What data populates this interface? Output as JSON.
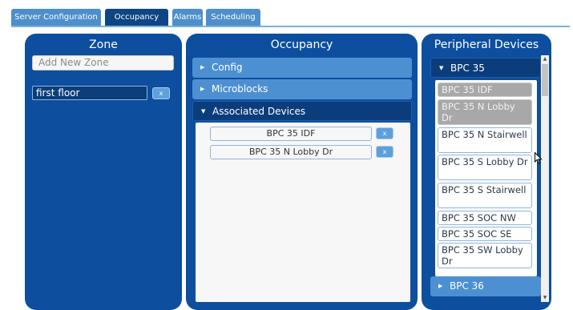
{
  "tabs": [
    {
      "label": "Server Configuration"
    },
    {
      "label": "Occupancy"
    },
    {
      "label": "Alarms"
    },
    {
      "label": "Scheduling"
    }
  ],
  "zone": {
    "title": "Zone",
    "input_placeholder": "Add New Zone",
    "zones": [
      {
        "label": "first floor",
        "remove_label": "x"
      }
    ]
  },
  "occupancy": {
    "title": "Occupancy",
    "sections": [
      {
        "label": "Config",
        "expanded": false
      },
      {
        "label": "Microblocks",
        "expanded": false
      },
      {
        "label": "Associated Devices",
        "expanded": true
      }
    ],
    "associated_devices": [
      {
        "label": "BPC 35 IDF",
        "remove_label": "x"
      },
      {
        "label": "BPC 35 N Lobby Dr",
        "remove_label": "x"
      }
    ]
  },
  "peripherals": {
    "title": "Peripheral Devices",
    "groups": [
      {
        "label": "BPC 35",
        "expanded": true
      },
      {
        "label": "BPC 36",
        "expanded": false
      }
    ],
    "devices": [
      {
        "label": "BPC 35 IDF",
        "selected": true
      },
      {
        "label": "BPC 35 N Lobby Dr",
        "selected": true
      },
      {
        "label": "BPC 35 N Stairwell",
        "selected": false
      },
      {
        "label": "BPC 35 S Lobby Dr",
        "selected": false
      },
      {
        "label": "BPC 35 S Stairwell",
        "selected": false
      },
      {
        "label": "BPC 35 SOC NW",
        "selected": false
      },
      {
        "label": "BPC 35 SOC SE",
        "selected": false
      },
      {
        "label": "BPC 35 SW Lobby Dr",
        "selected": false
      }
    ]
  },
  "icons": {
    "expanded": "triangle-down-icon",
    "collapsed": "triangle-right-icon",
    "cursor": "mouse-pointer-icon"
  },
  "colors": {
    "panel": "#0d4f9e",
    "accordion": "#4d90d2",
    "accordion_open": "#0b3d7c",
    "tab": "#4d8fcb",
    "tab_active": "#0d4585",
    "selected_device": "#a8a8a8"
  }
}
